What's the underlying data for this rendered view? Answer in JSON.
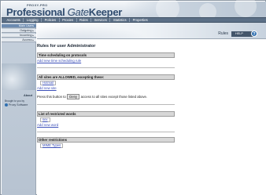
{
  "header": {
    "version": "PROXY-PRO",
    "logo_main": "Professional ",
    "logo_gate": "Gate",
    "logo_keeper": "Keeper"
  },
  "menu": [
    "Accounts",
    "Logging",
    "Policies",
    "Proxies",
    "Rules",
    "Services",
    "Statistics",
    "Properties"
  ],
  "sidebar": {
    "items": [
      {
        "label": "Main Users",
        "active": true
      },
      {
        "label": "Outgoing",
        "active": false
      },
      {
        "label": "Incoming",
        "active": false
      },
      {
        "label": "Access",
        "active": false
      }
    ],
    "about": "About",
    "brought": "Brought to you by",
    "brand": "Proxy Software"
  },
  "crumb": {
    "section": "Rules",
    "help": "HELP",
    "help_icon_text": "?"
  },
  "main": {
    "title": "Rules for user Administrator",
    "time": {
      "header": "Time scheduling on protocols",
      "link": "Add new time scheduling rule"
    },
    "sites": {
      "header": "All sites are ALLOWED, excepting these:",
      "entry": "Hotmail",
      "link": "Add new site"
    },
    "deny": {
      "before": "Press this button to",
      "button": "Deny",
      "after": "access to all sites except those listed above."
    },
    "words": {
      "header": "List of restricted words",
      "entry": "sex",
      "link": "Add new word"
    },
    "other": {
      "header": "Other restrictions",
      "entry": "MIME Types"
    }
  },
  "colors": {
    "menu_bg": "#5b6f86",
    "section_header_bg": "#d7d7d7",
    "link": "#3b4fb8",
    "active_side": "#6c8bb1"
  }
}
